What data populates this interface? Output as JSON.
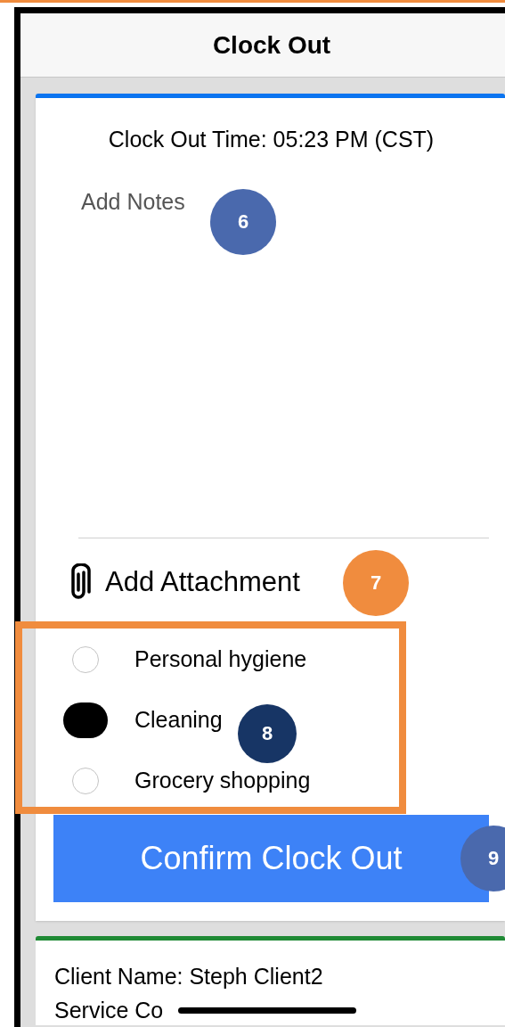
{
  "header": {
    "title": "Clock Out"
  },
  "clock_out": {
    "time_label": "Clock Out Time: 05:23 PM (CST)",
    "notes": {
      "placeholder": "Add Notes",
      "marker": {
        "label": "6",
        "color": "#4a69ad"
      }
    },
    "attachment": {
      "label": "Add Attachment",
      "marker": {
        "label": "7",
        "color": "#f08c3e"
      }
    },
    "tasks": {
      "options": [
        {
          "label": "Personal hygiene",
          "selected": false
        },
        {
          "label": "Cleaning",
          "selected": true
        },
        {
          "label": "Grocery shopping",
          "selected": false
        }
      ],
      "marker": {
        "label": "8",
        "color": "#173565"
      }
    },
    "confirm_button": {
      "label": "Confirm Clock Out",
      "marker": {
        "label": "9",
        "color": "#4a69ad"
      }
    }
  },
  "client": {
    "lines": [
      "Client Name: Steph Client2",
      "Service Co"
    ]
  }
}
